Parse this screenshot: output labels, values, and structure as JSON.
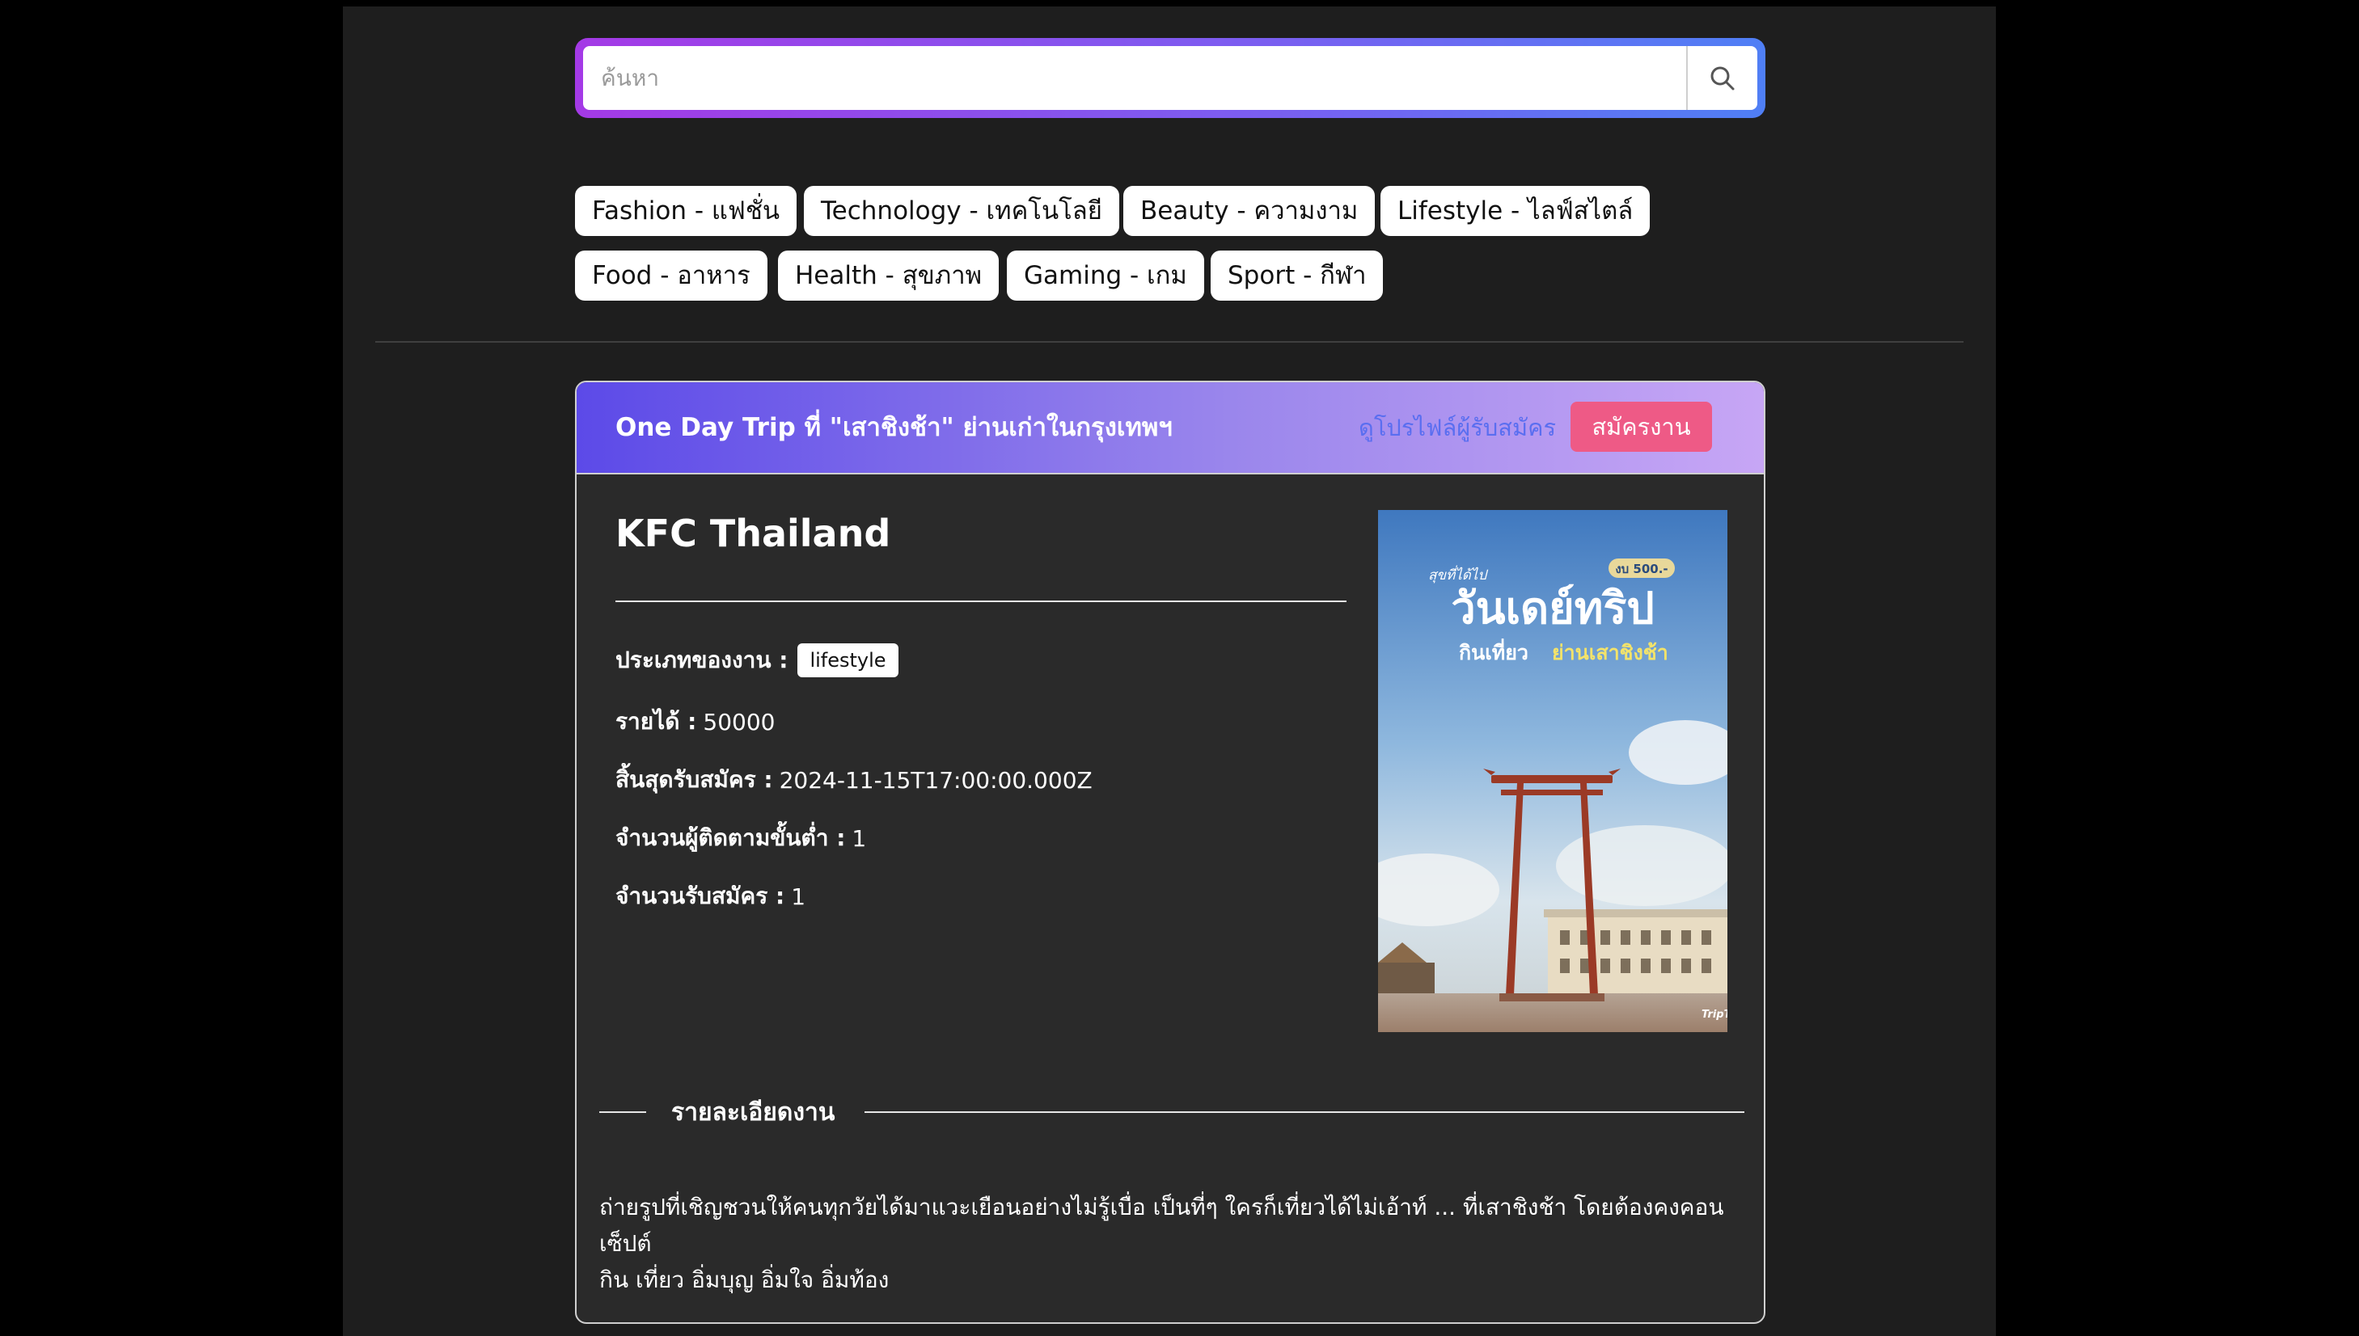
{
  "search": {
    "placeholder": "ค้นหา"
  },
  "categories": [
    "Fashion - แฟชั่น",
    "Technology - เทคโนโลยี",
    "Beauty - ความงาม",
    "Lifestyle - ไลฟ์สไตล์",
    "Food - อาหาร",
    "Health - สุขภาพ",
    "Gaming - เกม",
    "Sport - กีฬา"
  ],
  "job": {
    "title": "One Day Trip ที่ \"เสาชิงช้า\" ย่านเก่าในกรุงเทพฯ",
    "profile_link": "ดูโปรไฟล์ผู้รับสมัคร",
    "apply_label": "สมัครงาน",
    "company": "KFC Thailand",
    "type_label": "ประเภทของงาน :",
    "type_value": "lifestyle",
    "income_label": "รายได้ :",
    "income_value": "50000",
    "deadline_label": "สิ้นสุดรับสมัคร :",
    "deadline_value": "2024-11-15T17:00:00.000Z",
    "min_followers_label": "จำนวนผู้ติดตามขั้นต่ำ :",
    "min_followers_value": "1",
    "openings_label": "จำนวนรับสมัคร :",
    "openings_value": "1",
    "details_heading": "รายละเอียดงาน",
    "description_line1": "ถ่ายรูปที่เชิญชวนให้คนทุกวัยได้มาแวะเยือนอย่างไม่รู้เบื่อ เป็นที่ๆ ใครก็เที่ยวได้ไม่เอ้าท์ ... ที่เสาชิงช้า โดยต้องคงคอนเซ็ปต์",
    "description_line2": "กิน เที่ยว อิ่มบุญ อิ่มใจ อิ่มท้อง"
  },
  "poster": {
    "small_text": "สุขที่ได้ไป",
    "headline": "วันเดย์ทริป",
    "subline_a": "กินเที่ยว",
    "subline_b": "ย่านเสาชิงช้า",
    "price_badge": "งบ 500.-",
    "brand": "TripTH"
  },
  "colors": {
    "search_gradient": [
      "#a43ae6",
      "#4f7ff5"
    ],
    "header_gradient": [
      "#5c4ae8",
      "#c7a6f5"
    ],
    "apply_button": "#ee5a86",
    "profile_link": "#5a6ef0"
  },
  "icons": {
    "search": "search-icon"
  }
}
